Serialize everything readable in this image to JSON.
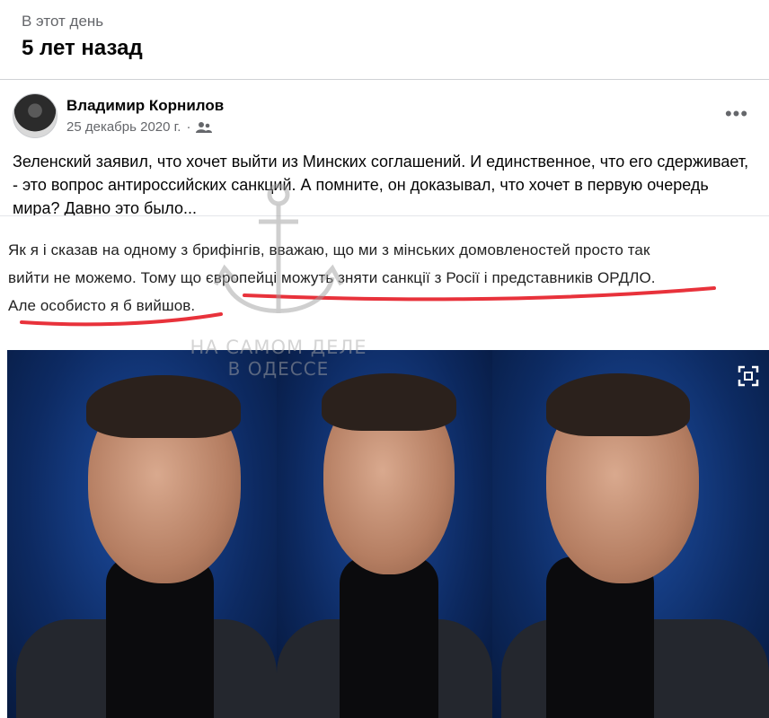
{
  "memory": {
    "label": "В этот день",
    "title": "5 лет назад"
  },
  "post": {
    "author": "Владимир Корнилов",
    "date": "25 декабрь 2020 г.",
    "separator_dot": "·",
    "audience_icon": "friends-icon",
    "more_icon": "more-options-icon",
    "text": "Зеленский заявил, что хочет выйти из Минских соглашений. И единственное, что его сдерживает, - это вопрос антироссийских санкций. А помните, он доказывал, что хочет в первую очередь мира? Давно это было...",
    "quote_lines": [
      "Як я і сказав на одному з брифінгів, вважаю, що ми з мінських домовленостей просто так",
      "вийти не можемо. Тому що європейці можуть зняти санкції з Росії і представників ОРДЛО.",
      "Але особисто я б вийшов."
    ],
    "underline_color": "#e8323b",
    "watermark": {
      "line1": "НА САМОМ ДЕЛЕ",
      "line2": "В ОДЕССЕ"
    },
    "photo_expand_icon": "expand-icon"
  }
}
